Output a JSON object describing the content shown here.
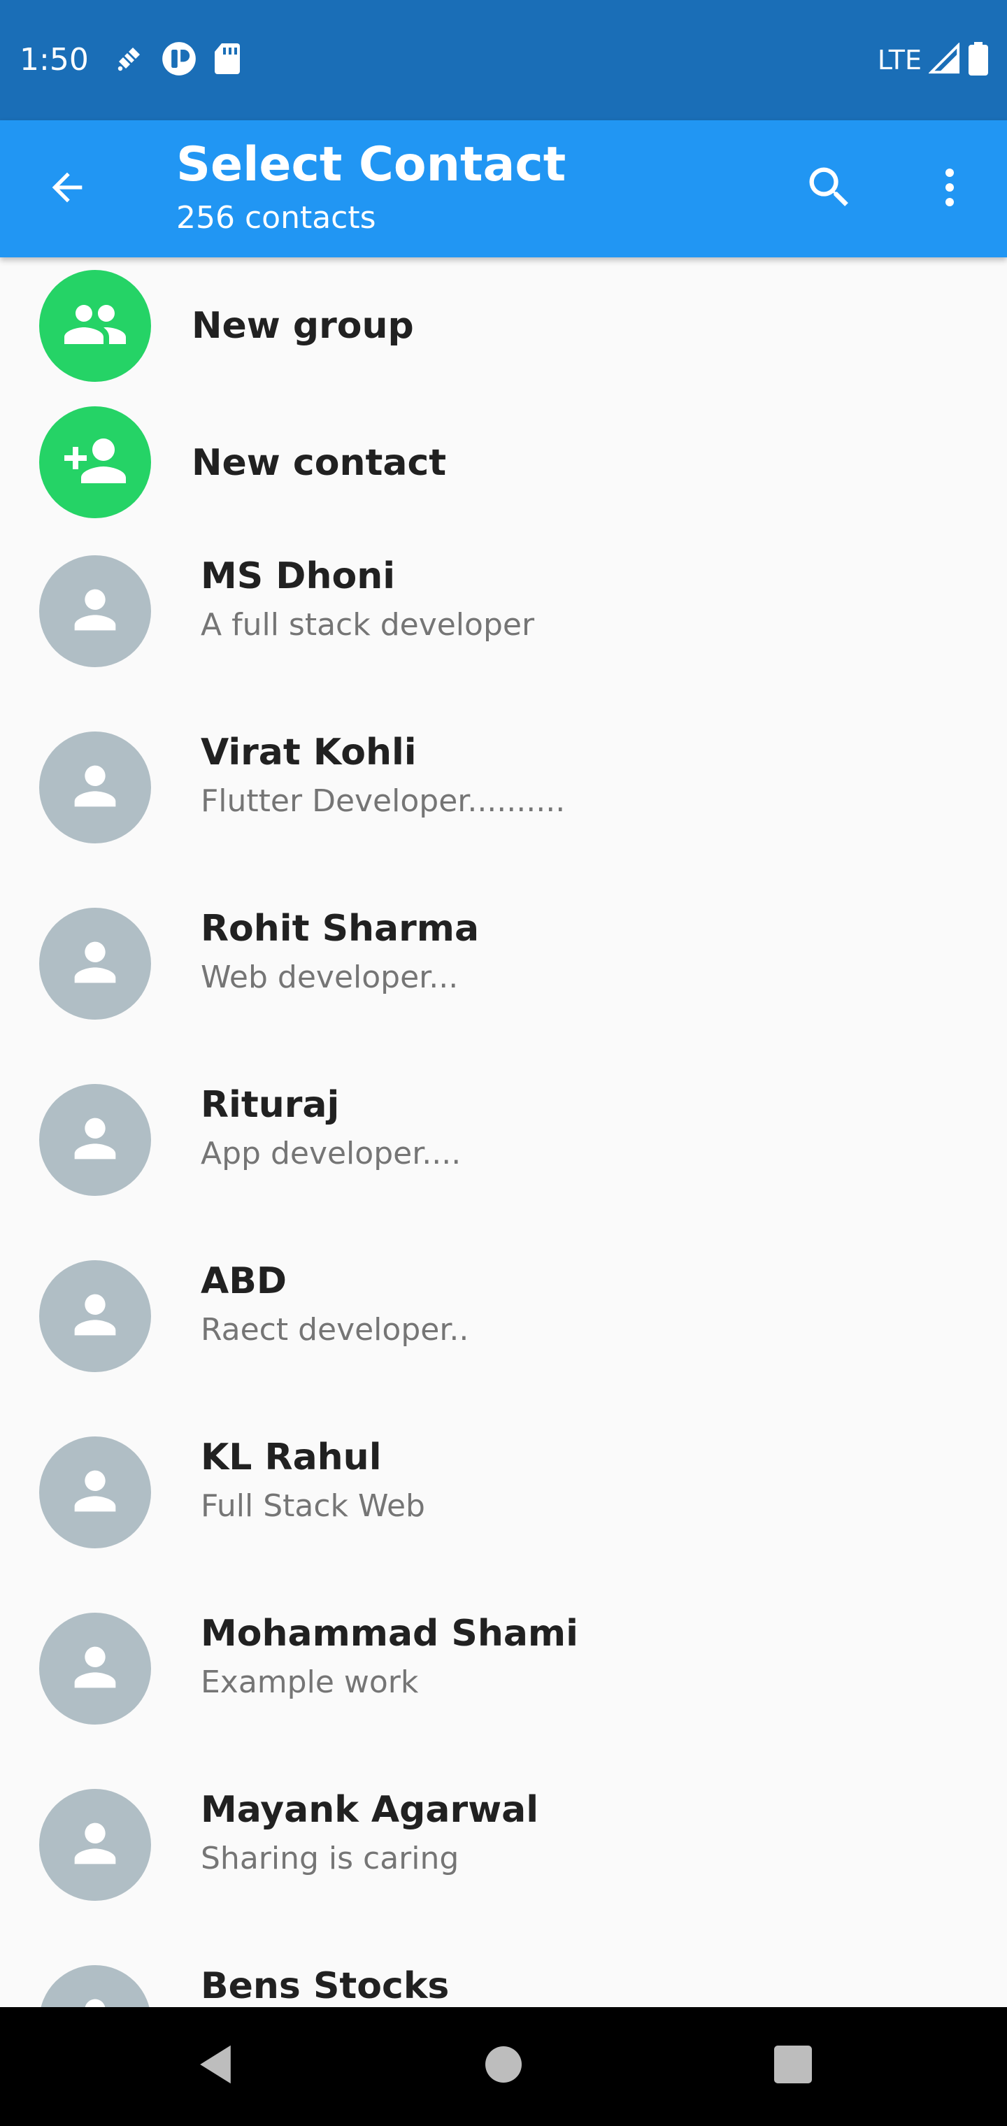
{
  "status_bar": {
    "time": "1:50",
    "network": "LTE",
    "icons": [
      "satellite-icon",
      "app-notification-icon",
      "sd-card-icon",
      "signal-icon",
      "battery-icon"
    ]
  },
  "app_bar": {
    "title": "Select Contact",
    "subtitle": "256 contacts",
    "color": "#2196f3",
    "icons": [
      "back-arrow-icon",
      "search-icon",
      "more-vert-icon"
    ]
  },
  "actions": [
    {
      "label": "New group",
      "icon": "group-icon",
      "color": "#25d366"
    },
    {
      "label": "New contact",
      "icon": "person-add-icon",
      "color": "#25d366"
    }
  ],
  "contacts": [
    {
      "name": "MS Dhoni",
      "status": "A full stack developer"
    },
    {
      "name": "Virat Kohli",
      "status": "Flutter Developer.........."
    },
    {
      "name": "Rohit Sharma",
      "status": "Web developer..."
    },
    {
      "name": "Rituraj",
      "status": "App developer...."
    },
    {
      "name": "ABD",
      "status": "Raect developer.."
    },
    {
      "name": "KL Rahul",
      "status": "Full Stack Web"
    },
    {
      "name": "Mohammad Shami",
      "status": "Example work"
    },
    {
      "name": "Mayank Agarwal",
      "status": "Sharing is caring"
    },
    {
      "name": "Bens Stocks",
      "status": ""
    }
  ],
  "nav_bar": {
    "icons": [
      "nav-back-icon",
      "nav-home-icon",
      "nav-recents-icon"
    ]
  }
}
